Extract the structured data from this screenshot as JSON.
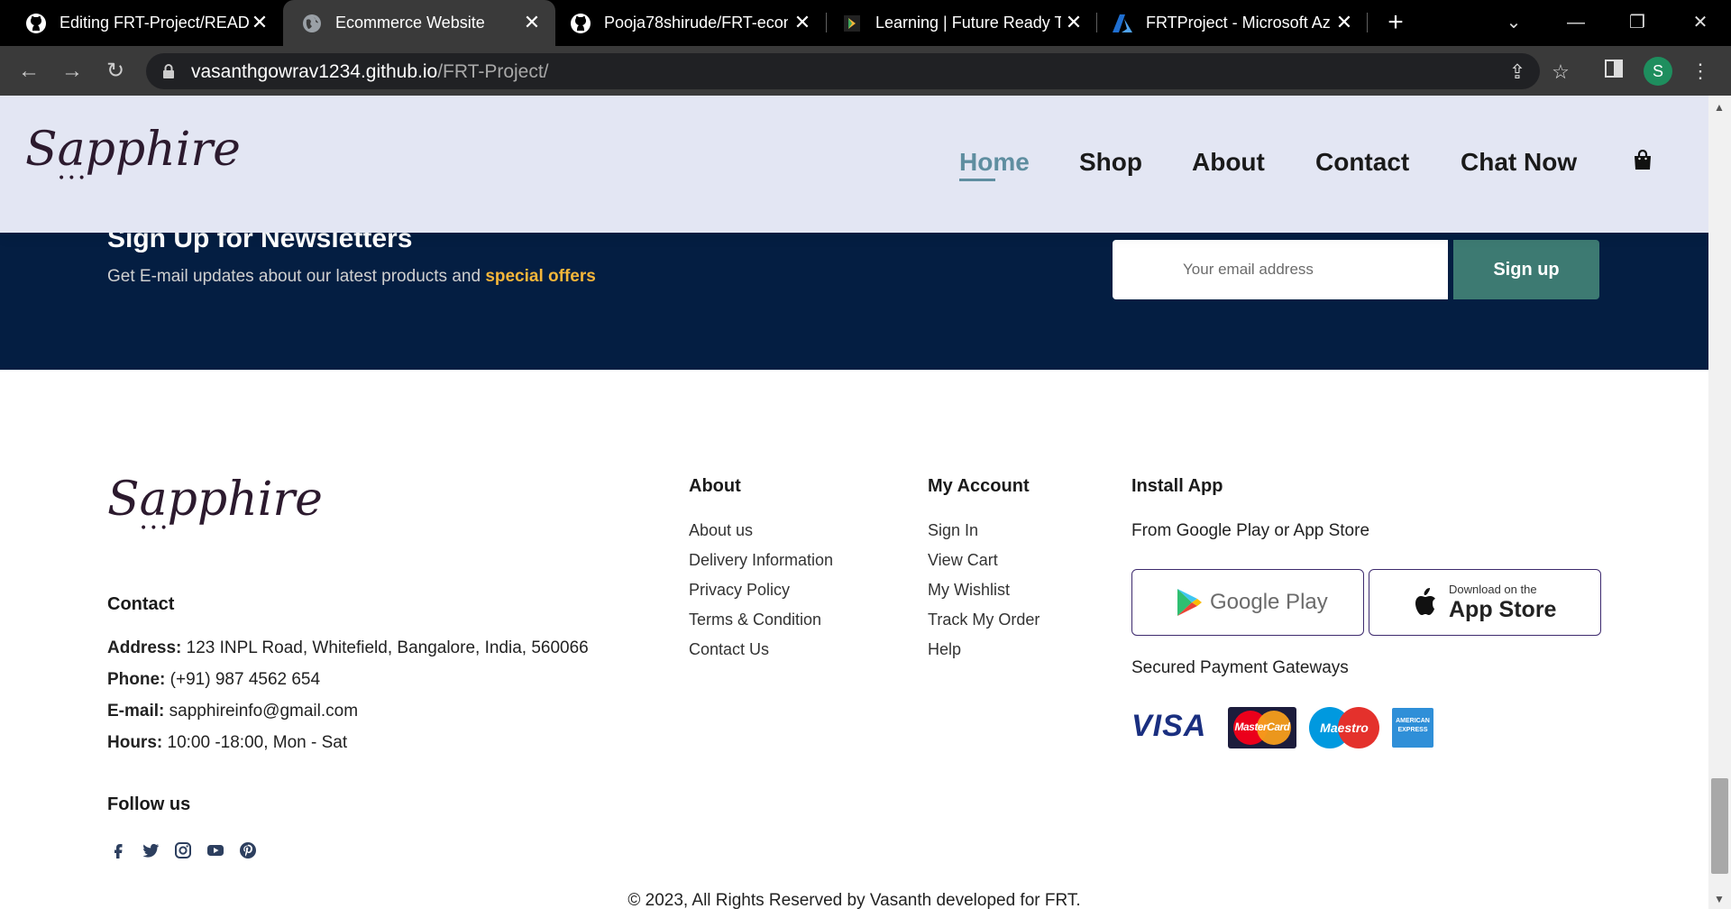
{
  "browser": {
    "tabs": [
      {
        "title": "Editing FRT-Project/READ",
        "icon": "github-icon"
      },
      {
        "title": "Ecommerce Website",
        "icon": "globe-icon"
      },
      {
        "title": "Pooja78shirude/FRT-econ",
        "icon": "github-icon"
      },
      {
        "title": "Learning | Future Ready T",
        "icon": "learning-icon"
      },
      {
        "title": "FRTProject - Microsoft Az",
        "icon": "azure-icon"
      }
    ],
    "url_host": "vasanthgowrav1234.github.io",
    "url_path": "/FRT-Project/",
    "profile_initial": "S"
  },
  "header": {
    "logo": "Sapphire",
    "nav": [
      "Home",
      "Shop",
      "About",
      "Contact",
      "Chat Now"
    ],
    "active_nav": "Home"
  },
  "newsletter": {
    "title": "Sign Up for Newsletters",
    "subtitle_prefix": "Get E-mail updates about our latest products and",
    "subtitle_highlight": "special offers",
    "email_placeholder": "Your email address",
    "button": "Sign up"
  },
  "footer": {
    "logo": "Sapphire",
    "contact_heading": "Contact",
    "address_label": "Address:",
    "address": "123 INPL Road, Whitefield, Bangalore, India, 560066",
    "phone_label": "Phone:",
    "phone": "(+91) 987 4562 654",
    "email_label": "E-mail:",
    "email": "sapphireinfo@gmail.com",
    "hours_label": "Hours:",
    "hours": "10:00 -18:00, Mon - Sat",
    "follow_heading": "Follow us",
    "about_heading": "About",
    "about_links": [
      "About us",
      "Delivery Information",
      "Privacy Policy",
      "Terms & Condition",
      "Contact Us"
    ],
    "account_heading": "My Account",
    "account_links": [
      "Sign In",
      "View Cart",
      "My Wishlist",
      "Track My Order",
      "Help"
    ],
    "install_heading": "Install App",
    "install_sub": "From Google Play or App Store",
    "google_play": "Google Play",
    "app_store_small": "Download on the",
    "app_store": "App Store",
    "payment_heading": "Secured Payment Gateways",
    "payments": [
      "VISA",
      "MasterCard",
      "Maestro",
      "AMERICAN EXPRESS"
    ],
    "copyright": "© 2023, All Rights Reserved by Vasanth developed for FRT."
  },
  "colors": {
    "header_bg": "#e3e6f3",
    "newsletter_bg": "#041e42",
    "accent": "#3d7a72",
    "highlight": "#f5b63a",
    "nav_active": "#5f8ea0"
  }
}
